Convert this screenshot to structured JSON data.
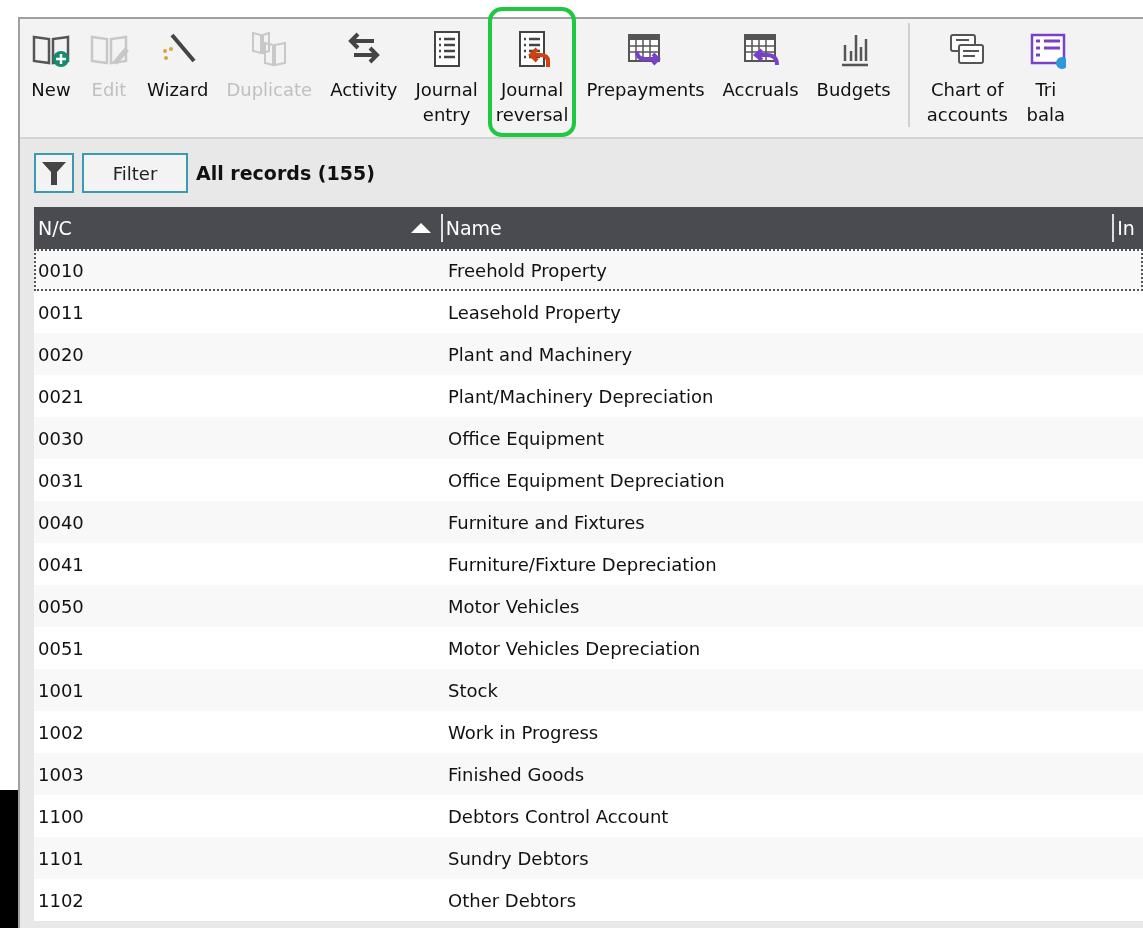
{
  "toolbar": {
    "groups": [
      {
        "buttons": [
          {
            "kind": "new",
            "label": [
              "New"
            ],
            "disabled": false,
            "highlighted": false
          },
          {
            "kind": "edit",
            "label": [
              "Edit"
            ],
            "disabled": true,
            "highlighted": false
          },
          {
            "kind": "wizard",
            "label": [
              "Wizard"
            ],
            "disabled": false,
            "highlighted": false
          },
          {
            "kind": "duplicate",
            "label": [
              "Duplicate"
            ],
            "disabled": true,
            "highlighted": false
          },
          {
            "kind": "activity",
            "label": [
              "Activity"
            ],
            "disabled": false,
            "highlighted": false
          },
          {
            "kind": "journal",
            "label": [
              "Journal",
              "entry"
            ],
            "disabled": false,
            "highlighted": false
          },
          {
            "kind": "reversal",
            "label": [
              "Journal",
              "reversal"
            ],
            "disabled": false,
            "highlighted": true
          },
          {
            "kind": "prepay",
            "label": [
              "Prepayments"
            ],
            "disabled": false,
            "highlighted": false
          },
          {
            "kind": "accrual",
            "label": [
              "Accruals"
            ],
            "disabled": false,
            "highlighted": false
          },
          {
            "kind": "budget",
            "label": [
              "Budgets"
            ],
            "disabled": false,
            "highlighted": false
          }
        ]
      },
      {
        "buttons": [
          {
            "kind": "chart",
            "label": [
              "Chart of",
              "accounts"
            ],
            "disabled": false,
            "highlighted": false
          },
          {
            "kind": "trial",
            "label": [
              "Tri",
              "bala"
            ],
            "disabled": false,
            "highlighted": false
          }
        ]
      }
    ]
  },
  "filter": {
    "button": "Filter",
    "summary": "All records (155)"
  },
  "table": {
    "columns": [
      {
        "label": "N/C",
        "sorted": true
      },
      {
        "label": "Name",
        "sorted": false
      },
      {
        "label": "In",
        "sorted": false
      }
    ],
    "rows": [
      {
        "nc": "0010",
        "name": "Freehold Property",
        "selected": true
      },
      {
        "nc": "0011",
        "name": "Leasehold Property",
        "selected": false
      },
      {
        "nc": "0020",
        "name": "Plant and Machinery",
        "selected": false
      },
      {
        "nc": "0021",
        "name": "Plant/Machinery Depreciation",
        "selected": false
      },
      {
        "nc": "0030",
        "name": "Office Equipment",
        "selected": false
      },
      {
        "nc": "0031",
        "name": "Office Equipment Depreciation",
        "selected": false
      },
      {
        "nc": "0040",
        "name": "Furniture and Fixtures",
        "selected": false
      },
      {
        "nc": "0041",
        "name": "Furniture/Fixture Depreciation",
        "selected": false
      },
      {
        "nc": "0050",
        "name": "Motor Vehicles",
        "selected": false
      },
      {
        "nc": "0051",
        "name": "Motor Vehicles Depreciation",
        "selected": false
      },
      {
        "nc": "1001",
        "name": "Stock",
        "selected": false
      },
      {
        "nc": "1002",
        "name": "Work in Progress",
        "selected": false
      },
      {
        "nc": "1003",
        "name": "Finished Goods",
        "selected": false
      },
      {
        "nc": "1100",
        "name": "Debtors Control Account",
        "selected": false
      },
      {
        "nc": "1101",
        "name": "Sundry Debtors",
        "selected": false
      },
      {
        "nc": "1102",
        "name": "Other Debtors",
        "selected": false
      }
    ]
  }
}
